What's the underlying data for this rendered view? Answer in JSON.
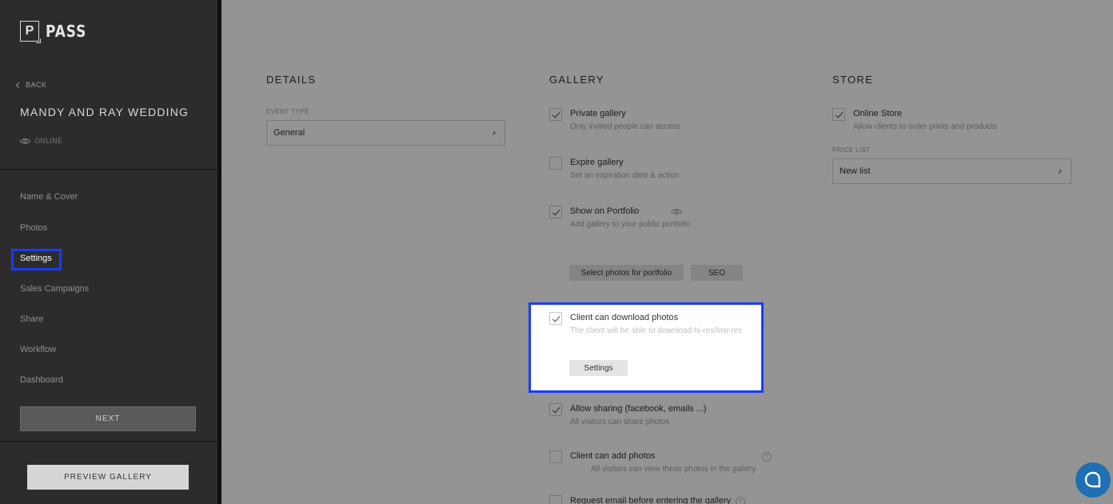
{
  "brand": {
    "logo_letter": "P",
    "name": "PASS"
  },
  "sidebar": {
    "back_label": "BACK",
    "event_title": "MANDY AND RAY WEDDING",
    "status": "ONLINE",
    "nav": [
      {
        "label": "Name & Cover"
      },
      {
        "label": "Photos"
      },
      {
        "label": "Settings"
      },
      {
        "label": "Sales Campaigns"
      },
      {
        "label": "Share"
      },
      {
        "label": "Workflow"
      },
      {
        "label": "Dashboard"
      }
    ],
    "next_label": "NEXT",
    "preview_label": "PREVIEW GALLERY"
  },
  "details": {
    "title": "DETAILS",
    "event_type_label": "EVENT TYPE",
    "event_type_value": "General"
  },
  "gallery": {
    "title": "GALLERY",
    "options": [
      {
        "title": "Private gallery",
        "desc": "Only invited people can access",
        "checked": true
      },
      {
        "title": "Expire gallery",
        "desc": "Set an expiration date & action",
        "checked": false
      },
      {
        "title": "Show on Portfolio",
        "desc": "Add gallery to your public portfolio",
        "checked": true
      },
      {
        "title": "Client can download photos",
        "desc": "The client will be able to download hi-res/low-res",
        "checked": true
      },
      {
        "title": "Allow sharing (facebook, emails ...)",
        "desc": "All visitors can share photos",
        "checked": true
      },
      {
        "title": "Client can add photos",
        "desc": "All visitors can view these photos in the gallery",
        "checked": false
      },
      {
        "title": "Request email before entering the gallery",
        "desc": "",
        "checked": false
      }
    ],
    "select_photos_label": "Select photos for portfolio",
    "seo_label": "SEO",
    "download_settings_label": "Settings"
  },
  "store": {
    "title": "STORE",
    "online_store_title": "Online Store",
    "online_store_desc": "Allow clients to order prints and products",
    "online_store_checked": true,
    "price_list_label": "PRICE LIST",
    "price_list_value": "New list"
  },
  "colors": {
    "highlight": "#1a3bff",
    "chat": "#1f6fb5"
  }
}
